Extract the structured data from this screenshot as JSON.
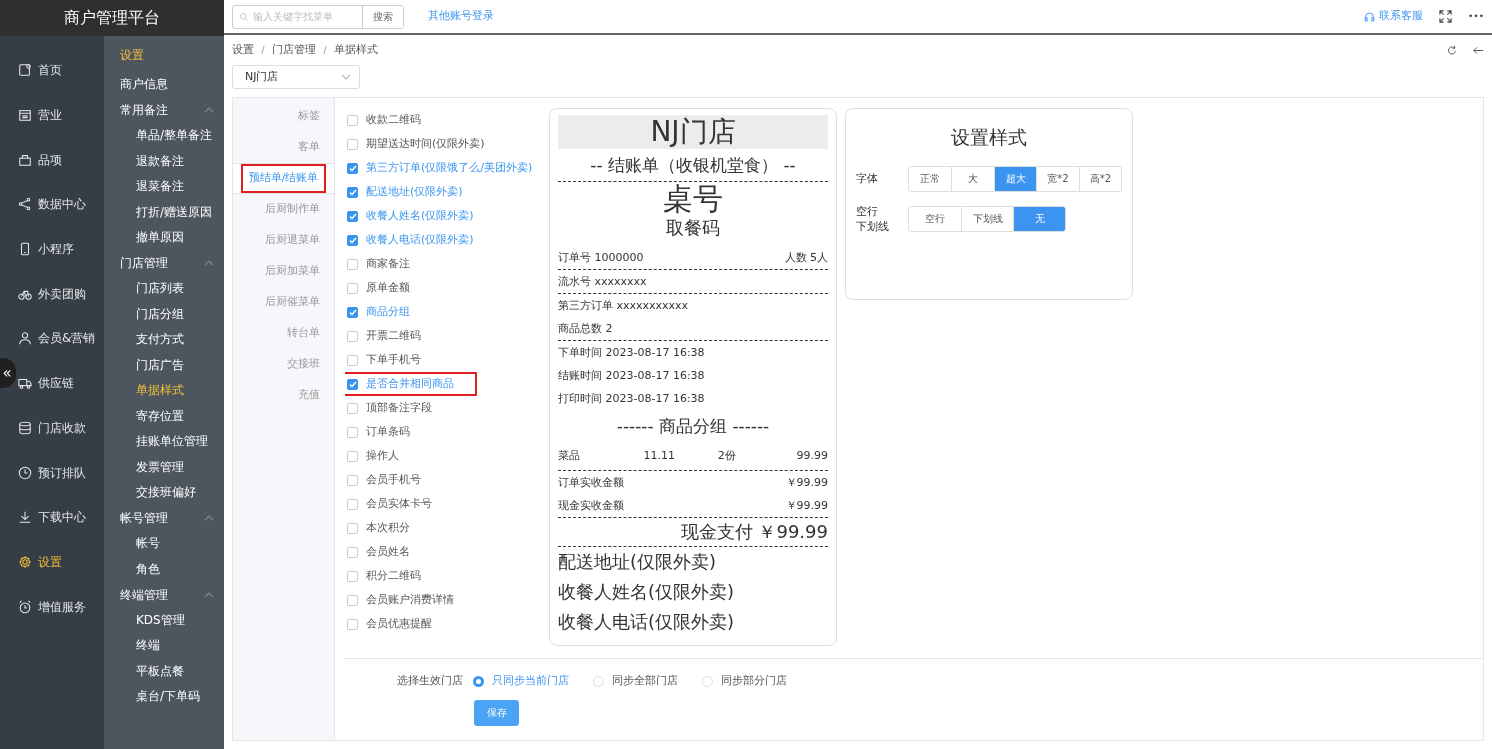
{
  "brand": "商户管理平台",
  "topbar": {
    "search_placeholder": "输入关键字找菜单",
    "search_button": "搜索",
    "other_login": "其他账号登录",
    "support": "联系客服",
    "more": "•••"
  },
  "sidebar": {
    "items": [
      {
        "label": "首页",
        "selected": false
      },
      {
        "label": "营业",
        "selected": false
      },
      {
        "label": "品项",
        "selected": false
      },
      {
        "label": "数据中心",
        "selected": false
      },
      {
        "label": "小程序",
        "selected": false
      },
      {
        "label": "外卖团购",
        "selected": false
      },
      {
        "label": "会员&营销",
        "selected": false
      },
      {
        "label": "供应链",
        "selected": false
      },
      {
        "label": "门店收款",
        "selected": false
      },
      {
        "label": "预订排队",
        "selected": false
      },
      {
        "label": "下载中心",
        "selected": false
      },
      {
        "label": "设置",
        "selected": true
      },
      {
        "label": "增值服务",
        "selected": false
      }
    ],
    "collapse": "«"
  },
  "submenu": {
    "title": "设置",
    "items": [
      {
        "label": "商户信息",
        "kind": "link",
        "selected": false
      },
      {
        "label": "常用备注",
        "kind": "group",
        "expanded": true,
        "children": [
          {
            "label": "单品/整单备注",
            "selected": false
          },
          {
            "label": "退款备注",
            "selected": false
          },
          {
            "label": "退菜备注",
            "selected": false
          },
          {
            "label": "打折/赠送原因",
            "selected": false
          },
          {
            "label": "撤单原因",
            "selected": false
          }
        ]
      },
      {
        "label": "门店管理",
        "kind": "group",
        "expanded": true,
        "children": [
          {
            "label": "门店列表",
            "selected": false
          },
          {
            "label": "门店分组",
            "selected": false
          },
          {
            "label": "支付方式",
            "selected": false
          },
          {
            "label": "门店广告",
            "selected": false
          },
          {
            "label": "单据样式",
            "selected": true
          },
          {
            "label": "寄存位置",
            "selected": false
          },
          {
            "label": "挂账单位管理",
            "selected": false
          },
          {
            "label": "发票管理",
            "selected": false
          },
          {
            "label": "交接班偏好",
            "selected": false
          }
        ]
      },
      {
        "label": "帐号管理",
        "kind": "group",
        "expanded": true,
        "children": [
          {
            "label": "帐号",
            "selected": false
          },
          {
            "label": "角色",
            "selected": false
          }
        ]
      },
      {
        "label": "终端管理",
        "kind": "group",
        "expanded": true,
        "children": [
          {
            "label": "KDS管理",
            "selected": false
          },
          {
            "label": "终端",
            "selected": false
          },
          {
            "label": "平板点餐",
            "selected": false
          },
          {
            "label": "桌台/下单码",
            "selected": false
          }
        ]
      }
    ]
  },
  "breadcrumb": [
    "设置",
    "门店管理",
    "单据样式"
  ],
  "store_select": {
    "value": "NJ门店"
  },
  "doc_tabs": [
    {
      "label": "标签",
      "selected": false
    },
    {
      "label": "客单",
      "selected": false
    },
    {
      "label": "预结单/结账单",
      "selected": true
    },
    {
      "label": "后厨制作单",
      "selected": false
    },
    {
      "label": "后厨退菜单",
      "selected": false
    },
    {
      "label": "后厨加菜单",
      "selected": false
    },
    {
      "label": "后厨催菜单",
      "selected": false
    },
    {
      "label": "转台单",
      "selected": false
    },
    {
      "label": "交接班",
      "selected": false
    },
    {
      "label": "充值",
      "selected": false
    }
  ],
  "fields": [
    {
      "label": "收款二维码",
      "checked": false,
      "highlighted": false
    },
    {
      "label": "期望送达时间(仅限外卖)",
      "checked": false,
      "highlighted": false
    },
    {
      "label": "第三方订单(仅限饿了么/美团外卖)",
      "checked": true,
      "highlighted": false
    },
    {
      "label": "配送地址(仅限外卖)",
      "checked": true,
      "highlighted": false
    },
    {
      "label": "收餐人姓名(仅限外卖)",
      "checked": true,
      "highlighted": false
    },
    {
      "label": "收餐人电话(仅限外卖)",
      "checked": true,
      "highlighted": false
    },
    {
      "label": "商家备注",
      "checked": false,
      "highlighted": false
    },
    {
      "label": "原单金额",
      "checked": false,
      "highlighted": false
    },
    {
      "label": "商品分组",
      "checked": true,
      "highlighted": false
    },
    {
      "label": "开票二维码",
      "checked": false,
      "highlighted": false
    },
    {
      "label": "下单手机号",
      "checked": false,
      "highlighted": false
    },
    {
      "label": "是否合并相同商品",
      "checked": true,
      "highlighted": true
    },
    {
      "label": "顶部备注字段",
      "checked": false,
      "highlighted": false
    },
    {
      "label": "订单条码",
      "checked": false,
      "highlighted": false
    },
    {
      "label": "操作人",
      "checked": false,
      "highlighted": false
    },
    {
      "label": "会员手机号",
      "checked": false,
      "highlighted": false
    },
    {
      "label": "会员实体卡号",
      "checked": false,
      "highlighted": false
    },
    {
      "label": "本次积分",
      "checked": false,
      "highlighted": false
    },
    {
      "label": "会员姓名",
      "checked": false,
      "highlighted": false
    },
    {
      "label": "积分二维码",
      "checked": false,
      "highlighted": false
    },
    {
      "label": "会员账户消费详情",
      "checked": false,
      "highlighted": false
    },
    {
      "label": "会员优惠提醒",
      "checked": false,
      "highlighted": false
    }
  ],
  "receipt": {
    "lines": [
      {
        "kind": "store",
        "text": "NJ门店"
      },
      {
        "kind": "heading",
        "text": "-- 结账单（收银机堂食） --",
        "rule": true
      },
      {
        "kind": "huge",
        "text": "桌号"
      },
      {
        "kind": "large",
        "text": "取餐码"
      },
      {
        "kind": "pair",
        "left": "订单号 1000000",
        "right": "人数 5人",
        "rule": true
      },
      {
        "kind": "text",
        "text": "流水号 xxxxxxxx",
        "rule": true
      },
      {
        "kind": "text",
        "text": "第三方订单 xxxxxxxxxxx"
      },
      {
        "kind": "text",
        "text": "商品总数 2",
        "rule": true
      },
      {
        "kind": "text",
        "text": "下单时间 2023-08-17 16:38"
      },
      {
        "kind": "text",
        "text": "结账时间 2023-08-17 16:38"
      },
      {
        "kind": "text",
        "text": "打印时间 2023-08-17 16:38"
      },
      {
        "kind": "heading",
        "text": "------ 商品分组 ------"
      },
      {
        "kind": "item",
        "cells": [
          "菜品",
          "11.11",
          "2份",
          "99.99"
        ],
        "rule": true
      },
      {
        "kind": "pair",
        "left": "订单实收金额",
        "right": "￥99.99"
      },
      {
        "kind": "pair",
        "left": "现金实收金额",
        "right": "￥99.99",
        "rule": true
      },
      {
        "kind": "total",
        "text": "现金支付 ￥99.99",
        "rule": true
      },
      {
        "kind": "big",
        "text": "配送地址(仅限外卖)"
      },
      {
        "kind": "big",
        "text": "收餐人姓名(仅限外卖)"
      },
      {
        "kind": "big",
        "text": "收餐人电话(仅限外卖)"
      }
    ]
  },
  "style_panel": {
    "title": "设置样式",
    "rows": [
      {
        "label_lines": [
          "字体"
        ],
        "options": [
          {
            "label": "正常",
            "selected": false
          },
          {
            "label": "大",
            "selected": false
          },
          {
            "label": "超大",
            "selected": true
          },
          {
            "label": "宽*2",
            "selected": false
          },
          {
            "label": "高*2",
            "selected": false
          }
        ]
      },
      {
        "label_lines": [
          "空行",
          "下划线"
        ],
        "options": [
          {
            "label": "空行",
            "selected": false
          },
          {
            "label": "下划线",
            "selected": false
          },
          {
            "label": "无",
            "selected": true
          }
        ]
      }
    ]
  },
  "apply": {
    "label": "选择生效门店",
    "options": [
      {
        "label": "只同步当前门店",
        "selected": true
      },
      {
        "label": "同步全部门店",
        "selected": false
      },
      {
        "label": "同步部分门店",
        "selected": false
      }
    ]
  },
  "save_button": "保存"
}
